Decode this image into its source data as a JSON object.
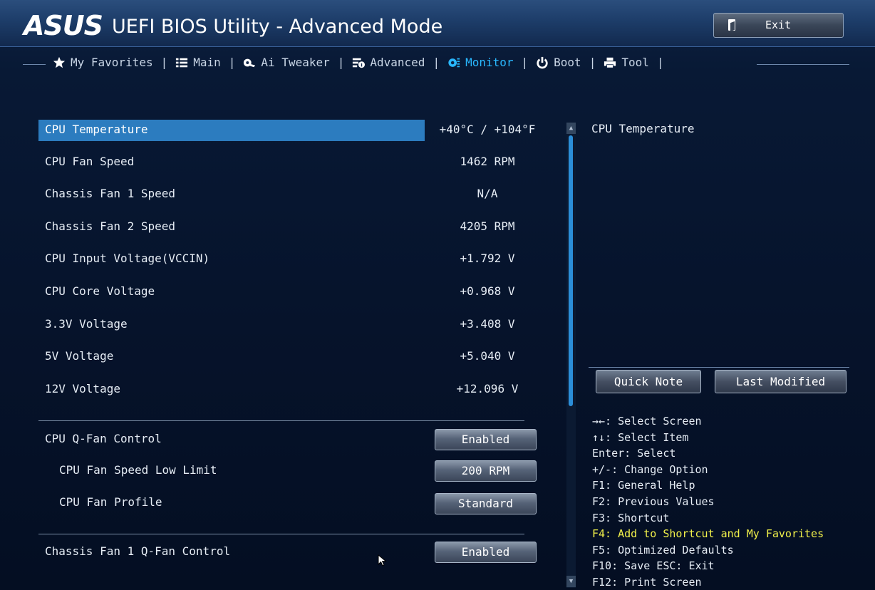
{
  "header": {
    "brand": "ASUS",
    "title": "UEFI BIOS Utility - Advanced Mode",
    "exit_label": "Exit"
  },
  "tabs": [
    {
      "label": "My Favorites",
      "icon": "star-icon"
    },
    {
      "label": "Main",
      "icon": "list-icon"
    },
    {
      "label": "Ai Tweaker",
      "icon": "tweaker-icon"
    },
    {
      "label": "Advanced",
      "icon": "advanced-icon"
    },
    {
      "label": "Monitor",
      "icon": "monitor-icon",
      "active": true
    },
    {
      "label": "Boot",
      "icon": "power-icon"
    },
    {
      "label": "Tool",
      "icon": "printer-icon"
    }
  ],
  "readings": [
    {
      "label": "CPU Temperature",
      "value": "+40°C / +104°F"
    },
    {
      "label": "CPU Fan Speed",
      "value": "1462 RPM"
    },
    {
      "label": "Chassis Fan 1 Speed",
      "value": "N/A"
    },
    {
      "label": "Chassis Fan 2 Speed",
      "value": "4205 RPM"
    },
    {
      "label": "CPU Input Voltage(VCCIN)",
      "value": "+1.792 V"
    },
    {
      "label": "CPU Core Voltage",
      "value": "+0.968 V"
    },
    {
      "label": "3.3V Voltage",
      "value": "+3.408 V"
    },
    {
      "label": "5V Voltage",
      "value": "+5.040 V"
    },
    {
      "label": "12V Voltage",
      "value": "+12.096 V"
    }
  ],
  "options": [
    {
      "label": "CPU Q-Fan Control",
      "value": "Enabled"
    },
    {
      "label": "CPU Fan Speed Low Limit",
      "value": "200 RPM"
    },
    {
      "label": "CPU Fan Profile",
      "value": "Standard"
    },
    {
      "label": "Chassis Fan 1 Q-Fan Control",
      "value": "Enabled"
    }
  ],
  "help": {
    "title": "CPU Temperature",
    "quick_note": "Quick Note",
    "last_modified": "Last Modified",
    "keys": [
      "→←: Select Screen",
      "↑↓: Select Item",
      "Enter: Select",
      "+/-: Change Option",
      "F1: General Help",
      "F2: Previous Values",
      "F3: Shortcut",
      "F4: Add to Shortcut and My Favorites",
      "F5: Optimized Defaults",
      "F10: Save  ESC: Exit",
      "F12: Print Screen"
    ]
  },
  "colors": {
    "accent": "#29b8ff",
    "selection": "#2c7cbf",
    "highlight_key": "#f0f04a"
  }
}
